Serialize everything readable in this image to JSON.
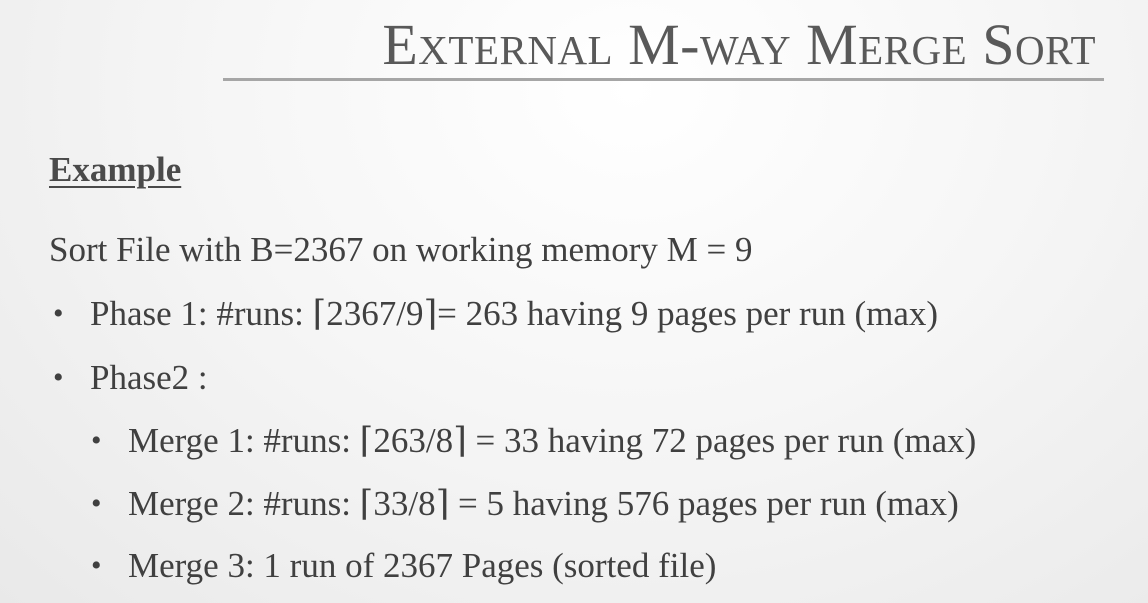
{
  "slide": {
    "title": "External M-way Merge Sort",
    "subtitle": "Example",
    "intro": "Sort File with B=2367 on working memory M = 9",
    "bullet_glyph": "•",
    "items": [
      {
        "level": 1,
        "text": "Phase 1:  #runs: ⌈2367/9⌉= 263 having 9 pages per run (max)"
      },
      {
        "level": 1,
        "text": "Phase2 :"
      },
      {
        "level": 2,
        "text": "Merge 1: #runs: ⌈263/8⌉ = 33 having 72 pages per run (max)"
      },
      {
        "level": 2,
        "text": "Merge 2: #runs: ⌈33/8⌉ = 5 having 576 pages per run (max)"
      },
      {
        "level": 2,
        "text": "Merge 3: 1 run of 2367 Pages (sorted file)"
      }
    ]
  }
}
